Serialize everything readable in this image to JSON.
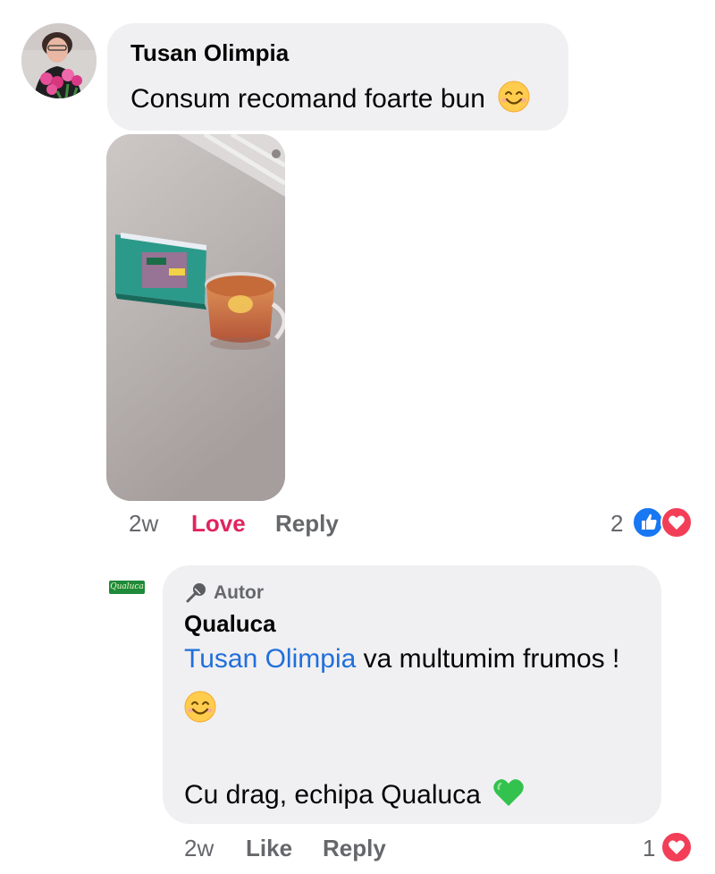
{
  "comment": {
    "author": "Tusan Olimpia",
    "text": "Consum recomand foarte bun",
    "emoji": "smiling-face-emoji",
    "photo": "tea-box-and-glass-of-tea-photo",
    "meta": {
      "time": "2w",
      "reaction_label": "Love",
      "reply_label": "Reply"
    },
    "reactions": {
      "count": "2",
      "types": [
        "like",
        "love"
      ]
    }
  },
  "reply": {
    "badge": "Autor",
    "author": "Qualuca",
    "logo_text": "Qualuca",
    "mention": "Tusan Olimpia",
    "text_line1": " va multumim frumos !",
    "text_line3": "Cu drag, echipa Qualuca",
    "meta": {
      "time": "2w",
      "like_label": "Like",
      "reply_label": "Reply"
    },
    "reactions": {
      "count": "1",
      "types": [
        "love"
      ]
    }
  },
  "colors": {
    "bubble": "#f0f0f2",
    "love": "#e0245e",
    "mention": "#216fdb",
    "meta": "#65676b",
    "like_blue": "#1877f2",
    "heart_red": "#f33e58"
  }
}
